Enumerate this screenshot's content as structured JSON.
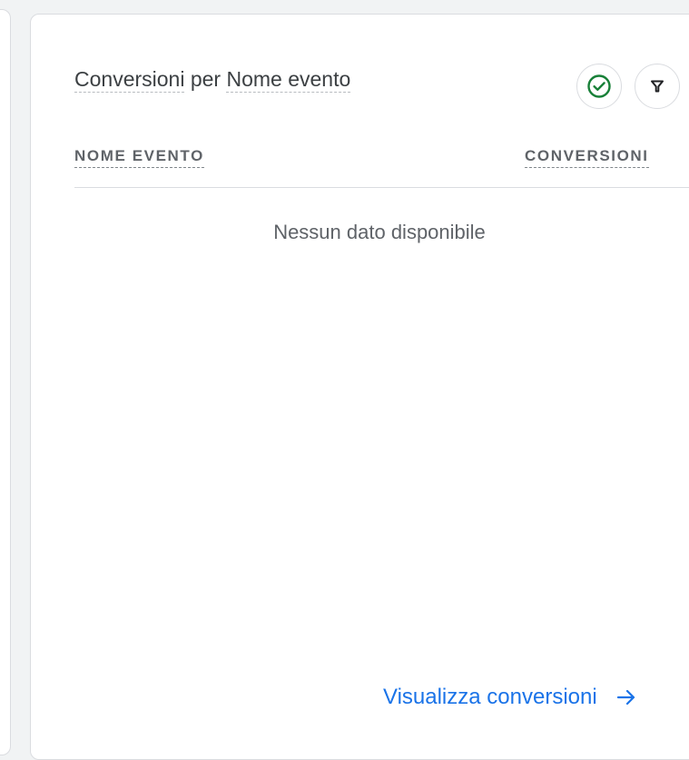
{
  "card": {
    "title_metric": "Conversioni",
    "title_connector": "per",
    "title_dimension": "Nome evento",
    "icons": {
      "status": "check-circle-icon",
      "filter": "filter-icon"
    },
    "colors": {
      "status_green": "#188038",
      "link_blue": "#1a73e8"
    }
  },
  "table": {
    "columns": [
      "NOME EVENTO",
      "CONVERSIONI"
    ],
    "rows": [],
    "empty_message": "Nessun dato disponibile"
  },
  "footer": {
    "link_label": "Visualizza conversioni",
    "link_icon": "arrow-right-icon"
  }
}
